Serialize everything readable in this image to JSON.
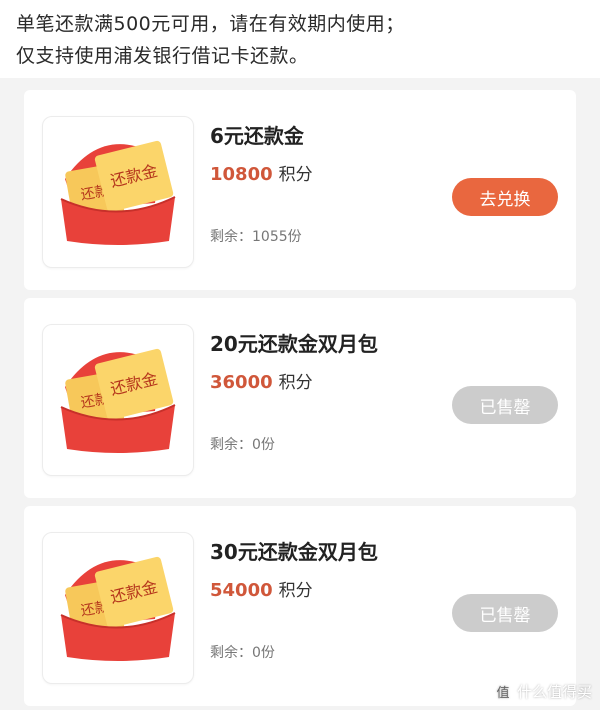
{
  "notice": {
    "line1": "单笔还款满500元可用，请在有效期内使用；",
    "line2": "仅支持使用浦发银行借记卡还款。"
  },
  "colors": {
    "accent": "#e9673f",
    "price": "#d0573a",
    "sold_out": "#cccccc",
    "envelope": "#e8413a",
    "ticket": "#f7c85a"
  },
  "items": [
    {
      "title": "6元还款金",
      "price": "10800",
      "price_unit": "积分",
      "remaining": "剩余：1055份",
      "button": "去兑换",
      "status": "available",
      "thumb_ticket_front": "还款金",
      "thumb_ticket_back": "还款"
    },
    {
      "title": "20元还款金双月包",
      "price": "36000",
      "price_unit": "积分",
      "remaining": "剩余：0份",
      "button": "已售罄",
      "status": "sold_out",
      "thumb_ticket_front": "还款金",
      "thumb_ticket_back": "还款"
    },
    {
      "title": "30元还款金双月包",
      "price": "54000",
      "price_unit": "积分",
      "remaining": "剩余：0份",
      "button": "已售罄",
      "status": "sold_out",
      "thumb_ticket_front": "还款金",
      "thumb_ticket_back": "还款"
    }
  ],
  "watermark": {
    "icon": "值",
    "text": "什么值得买"
  }
}
